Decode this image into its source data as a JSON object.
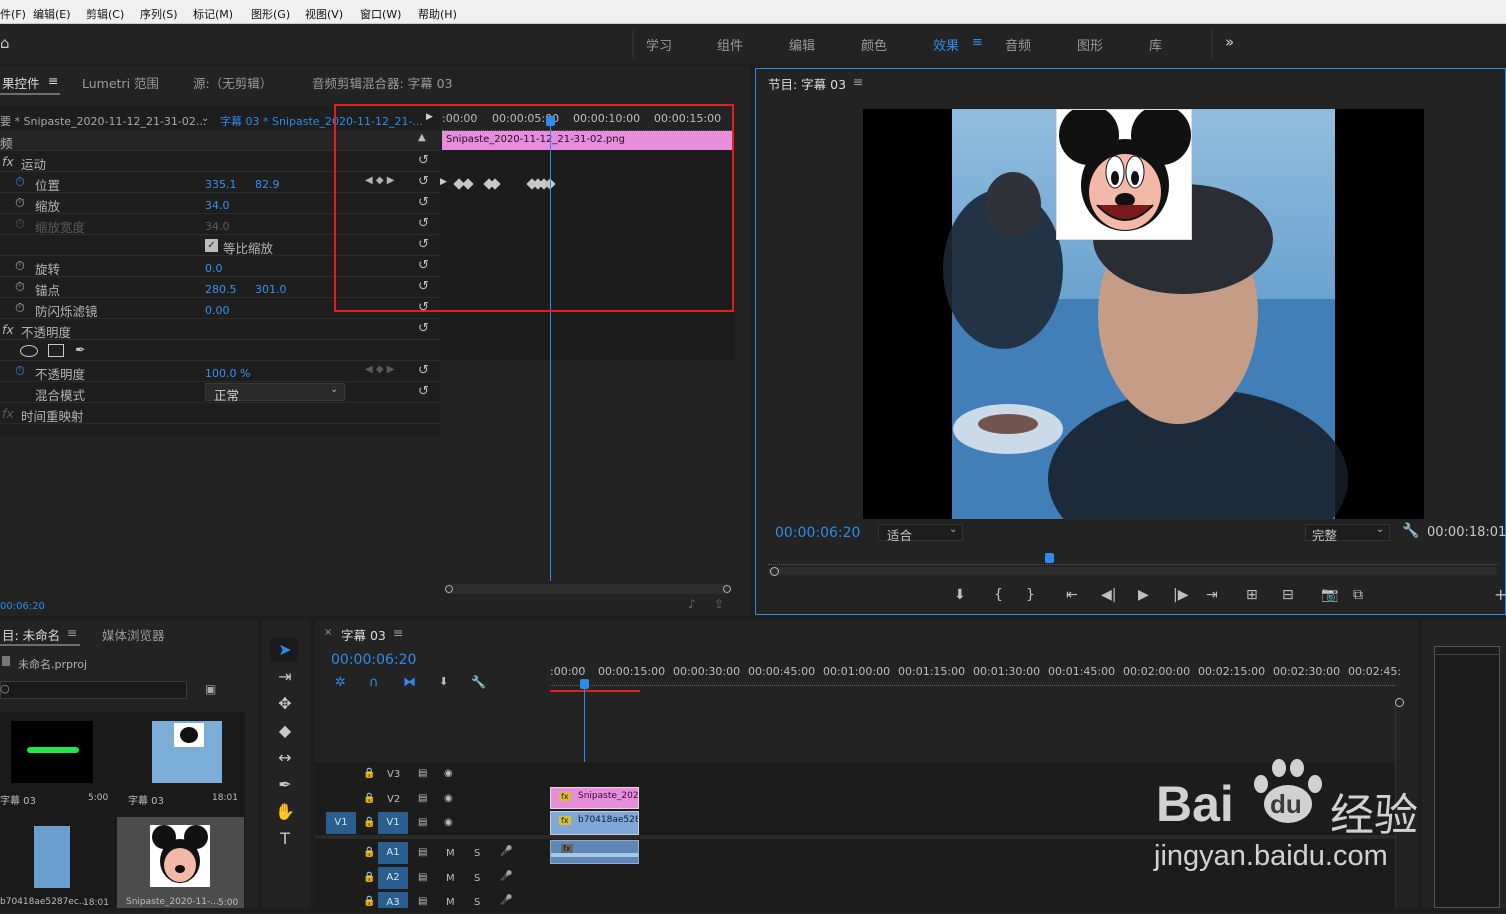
{
  "menu": {
    "items": [
      "件(F)",
      "编辑(E)",
      "剪辑(C)",
      "序列(S)",
      "标记(M)",
      "图形(G)",
      "视图(V)",
      "窗口(W)",
      "帮助(H)"
    ]
  },
  "workspaces": {
    "items": [
      "学习",
      "组件",
      "编辑",
      "颜色",
      "效果",
      "音频",
      "图形",
      "库"
    ],
    "active": "效果",
    "more": "»"
  },
  "effect_controls": {
    "tabs": [
      "果控件",
      "Lumetri 范围",
      "源:（无剪辑）",
      "音频剪辑混合器: 字幕 03"
    ],
    "source_label": "要 * Snipaste_2020-11-12_21-31-02...",
    "sequence_label": "字幕 03 * Snipaste_2020-11-12_21-...",
    "section_video": "频",
    "motion": "运动",
    "props": {
      "position": {
        "label": "位置",
        "x": "335.1",
        "y": "82.9"
      },
      "scale": {
        "label": "缩放",
        "v": "34.0"
      },
      "scale_width": {
        "label": "缩放宽度",
        "v": "34.0"
      },
      "uniform": {
        "label": "等比缩放"
      },
      "rotation": {
        "label": "旋转",
        "v": "0.0"
      },
      "anchor": {
        "label": "锚点",
        "x": "280.5",
        "y": "301.0"
      },
      "flicker": {
        "label": "防闪烁滤镜",
        "v": "0.00"
      },
      "opacity_group": "不透明度",
      "opacity": {
        "label": "不透明度",
        "v": "100.0 %"
      },
      "blend": {
        "label": "混合模式",
        "v": "正常"
      },
      "time_remap": "时间重映射"
    },
    "timeline": {
      "ticks": [
        ":00:00",
        "00:00:05:00",
        "00:00:10:00",
        "00:00:15:00"
      ],
      "clip": "Snipaste_2020-11-12_21-31-02.png"
    },
    "timecode": "00:06:20"
  },
  "program": {
    "title": "节目: 字幕 03",
    "timecode": "00:00:06:20",
    "fit": "适合",
    "quality": "完整",
    "duration": "00:00:18:01"
  },
  "project": {
    "tabs": [
      "目: 未命名",
      "媒体浏览器"
    ],
    "file": "未命名.prproj",
    "items": [
      {
        "name": "字幕 03",
        "dur": "5:00"
      },
      {
        "name": "字幕 03",
        "dur": "18:01"
      },
      {
        "name": "b70418ae5287ec...",
        "dur": "18:01"
      },
      {
        "name": "Snipaste_2020-11-...",
        "dur": "5:00"
      }
    ]
  },
  "timeline": {
    "tab": "字幕 03",
    "timecode": "00:00:06:20",
    "ticks": [
      ":00:00",
      "00:00:15:00",
      "00:00:30:00",
      "00:00:45:00",
      "00:01:00:00",
      "00:01:15:00",
      "00:01:30:00",
      "00:01:45:00",
      "00:02:00:00",
      "00:02:15:00",
      "00:02:30:00",
      "00:02:45:"
    ],
    "tracks": {
      "v3": "V3",
      "v2": "V2",
      "v1": "V1",
      "a1": "A1",
      "a2": "A2",
      "a3": "A3",
      "src_v1": "V1",
      "m": "M",
      "s": "S"
    },
    "clip_v2": "Snipaste_202",
    "clip_v1": "b70418ae528"
  },
  "watermark": {
    "brand": "Bai",
    "brand2": "du",
    "brand_cn": "经验",
    "url": "jingyan.baidu.com"
  }
}
